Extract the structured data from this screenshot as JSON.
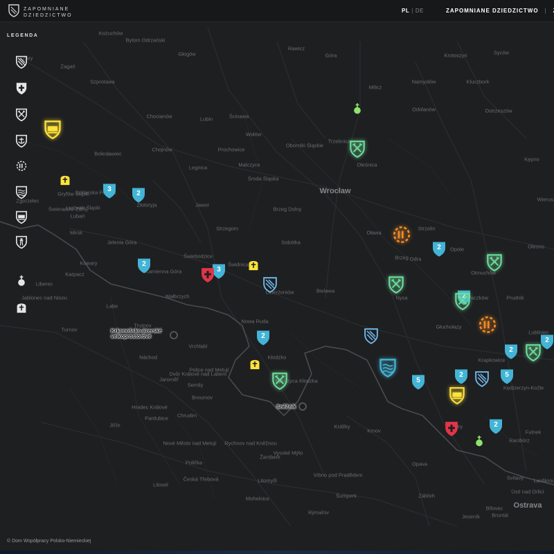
{
  "header": {
    "brand_line1": "ZAPOMNIANE",
    "brand_line2": "DZIEDZICTWO",
    "lang_pl": "PL",
    "lang_sep": "|",
    "lang_de": "DE",
    "nav_title": "ZAPOMNIANE DZIEDZICTWO",
    "nav_sep": "|",
    "nav_next": "ZA"
  },
  "legend": {
    "title": "LEGENDA",
    "items": [
      {
        "icon": "striped-shield-icon",
        "color": "#e6e6e6"
      },
      {
        "icon": "cross-shield-icon",
        "color": "#e6e6e6"
      },
      {
        "icon": "mining-shield-icon",
        "color": "#e6e6e6"
      },
      {
        "icon": "anchor-shield-icon",
        "color": "#e6e6e6"
      },
      {
        "icon": "gear-shield-icon",
        "color": "#e6e6e6"
      },
      {
        "icon": "water-shield-icon",
        "color": "#e6e6e6"
      },
      {
        "icon": "vehicle-shield-icon",
        "color": "#e6e6e6"
      },
      {
        "icon": "tower-shield-icon",
        "color": "#e6e6e6"
      },
      {
        "icon": "globus-cruciger-icon",
        "color": "#e6e6e6"
      },
      {
        "icon": "gravestone-icon",
        "color": "#e6e6e6"
      }
    ]
  },
  "map": {
    "colors": {
      "cluster": "#43b4d6",
      "mining": "#6ddc9a",
      "industry": "#f08a24",
      "military": "#ffe33a",
      "medical": "#e23548",
      "admin": "#6fb5e8",
      "water": "#43b4d6",
      "religion": "#8fe36a"
    },
    "places": [
      "Kożuchów",
      "Bytom Odrzański",
      "Głogów",
      "Rawicz",
      "Góra",
      "Zary",
      "Żagań",
      "Szprotawa",
      "Chocianów",
      "Lubin",
      "Ścinawa",
      "Wołów",
      "Oborniki Śląskie",
      "Trzebnica",
      "Oleśnica",
      "Bolesławiec",
      "Chojnów",
      "Legnica",
      "Prochowice",
      "Malczyce",
      "Środa Śląska",
      "Brzeg Dolny",
      "Jawor",
      "Strzegom",
      "Sobótka",
      "Jelenia Góra",
      "Kowary",
      "Karpacz",
      "Kamienna Góra",
      "Świebodzice",
      "Wałbrzych",
      "Świdnica",
      "Dzierżoniów",
      "Bielawa",
      "Nowa Ruda",
      "Kłodzko",
      "Bystrzyca Kłodzka",
      "Strzelin",
      "Oława",
      "Brzeg",
      "Opole",
      "Nysa",
      "Paczków",
      "Otmuchów",
      "Głuchołazy",
      "Prudnik",
      "Krapkowice",
      "Kędzierzyn-Koźle",
      "Racibórz",
      "Kluczbork",
      "Namysłów",
      "Syców",
      "Milicz",
      "Krotoszyn",
      "Odolanów",
      "Ostrzeszów",
      "Kępno",
      "Wieruszów",
      "Olesno",
      "Lubliniec",
      "Zgorzelec",
      "Lubań",
      "Gryfów Śląski",
      "Lwówek Śląski",
      "Złotoryja",
      "Świeradów-Zdrój",
      "Szklarska Poręba",
      "Mirsk",
      "Liberec",
      "Jablonec nad Nisou",
      "Turnov",
      "Trutnov",
      "Náchod",
      "Hradec Králové",
      "Pardubice",
      "Chrudim",
      "Jičín",
      "Semily",
      "Vrchlabí",
      "Dvůr Králové nad Labem",
      "Jaroměř",
      "Broumov",
      "Police nad Metují",
      "Nové Město nad Metují",
      "Rychnov nad Kněžnou",
      "Žamberk",
      "Králíky",
      "Šumperk",
      "Zábřeh",
      "Jeseník",
      "Bruntál",
      "Krnov",
      "Opava",
      "Vrbno pod Pradědem",
      "Rýmařov",
      "Litovel",
      "Mohelnice",
      "Česká Třebová",
      "Litomyšl",
      "Polička",
      "Vysoké Mýto",
      "Svitavy",
      "Ústí nad Orlicí",
      "Lanškroun",
      "Bílovec",
      "Fulnek",
      "Odry",
      "Hlučín",
      "Kravaře",
      "Kietrz",
      "Głubczyce"
    ],
    "city": "Wrocław",
    "city2": "Ostrava",
    "river_odra": "Odra",
    "river_labe": "Labe",
    "pois": [
      {
        "label": "Krkonošsko-jizerské velkoprostorové",
        "icon": "landmark-icon"
      },
      {
        "label": "Sněžník",
        "icon": "landmark-icon"
      }
    ],
    "clusters": [
      {
        "count": "3"
      },
      {
        "count": "2"
      },
      {
        "count": "2"
      },
      {
        "count": "3"
      },
      {
        "count": "2"
      },
      {
        "count": "2"
      },
      {
        "count": "2"
      },
      {
        "count": "2"
      },
      {
        "count": "2"
      },
      {
        "count": "5"
      },
      {
        "count": "2"
      },
      {
        "count": "5"
      },
      {
        "count": "2"
      }
    ]
  },
  "footer": {
    "copyright": "© Dom Współpracy Polsko-Niemieckiej"
  }
}
